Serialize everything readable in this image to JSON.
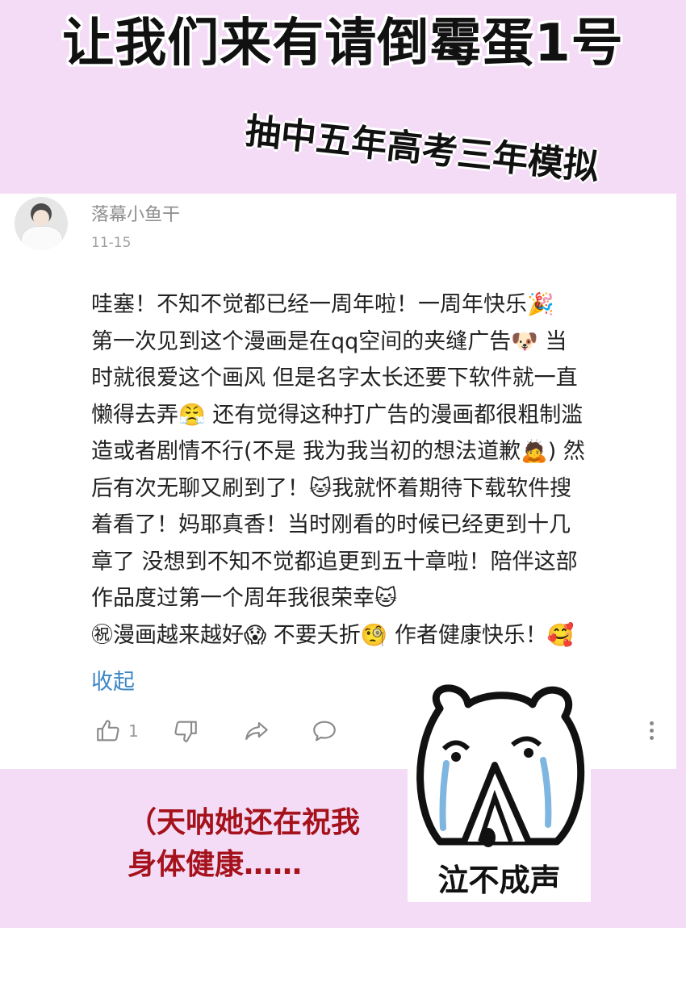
{
  "header": {
    "title": "让我们来有请倒霉蛋1号",
    "subtitle": "抽中五年高考三年模拟"
  },
  "comment": {
    "username": "落幕小鱼干",
    "date": "11-15",
    "lines": [
      "哇塞！不知不觉都已经一周年啦！一周年快乐🎉",
      "第一次见到这个漫画是在qq空间的夹缝广告🐶 当",
      "时就很爱这个画风 但是名字太长还要下软件就一直",
      "懒得去弄😤 还有觉得这种打广告的漫画都很粗制滥",
      "造或者剧情不行(不是 我为我当初的想法道歉🙇) 然",
      "后有次无聊又刷到了！🐱我就怀着期待下载软件搜",
      "着看了！妈耶真香！当时刚看的时候已经更到十几",
      "章了 没想到不知不觉都追更到五十章啦！陪伴这部",
      "作品度过第一个周年我很荣幸🐱",
      "㊗漫画越来越好😱 不要夭折🧐 作者健康快乐！🥰"
    ],
    "collapse_label": "收起",
    "like_count": "1",
    "icons": {
      "like": "thumbs-up-icon",
      "dislike": "thumbs-down-icon",
      "share": "share-icon",
      "reply": "comment-icon",
      "more": "more-vertical-icon"
    }
  },
  "note": {
    "line1": "（天呐她还在祝我",
    "line2": "身体健康……"
  },
  "sticker": {
    "label": "泣不成声"
  }
}
